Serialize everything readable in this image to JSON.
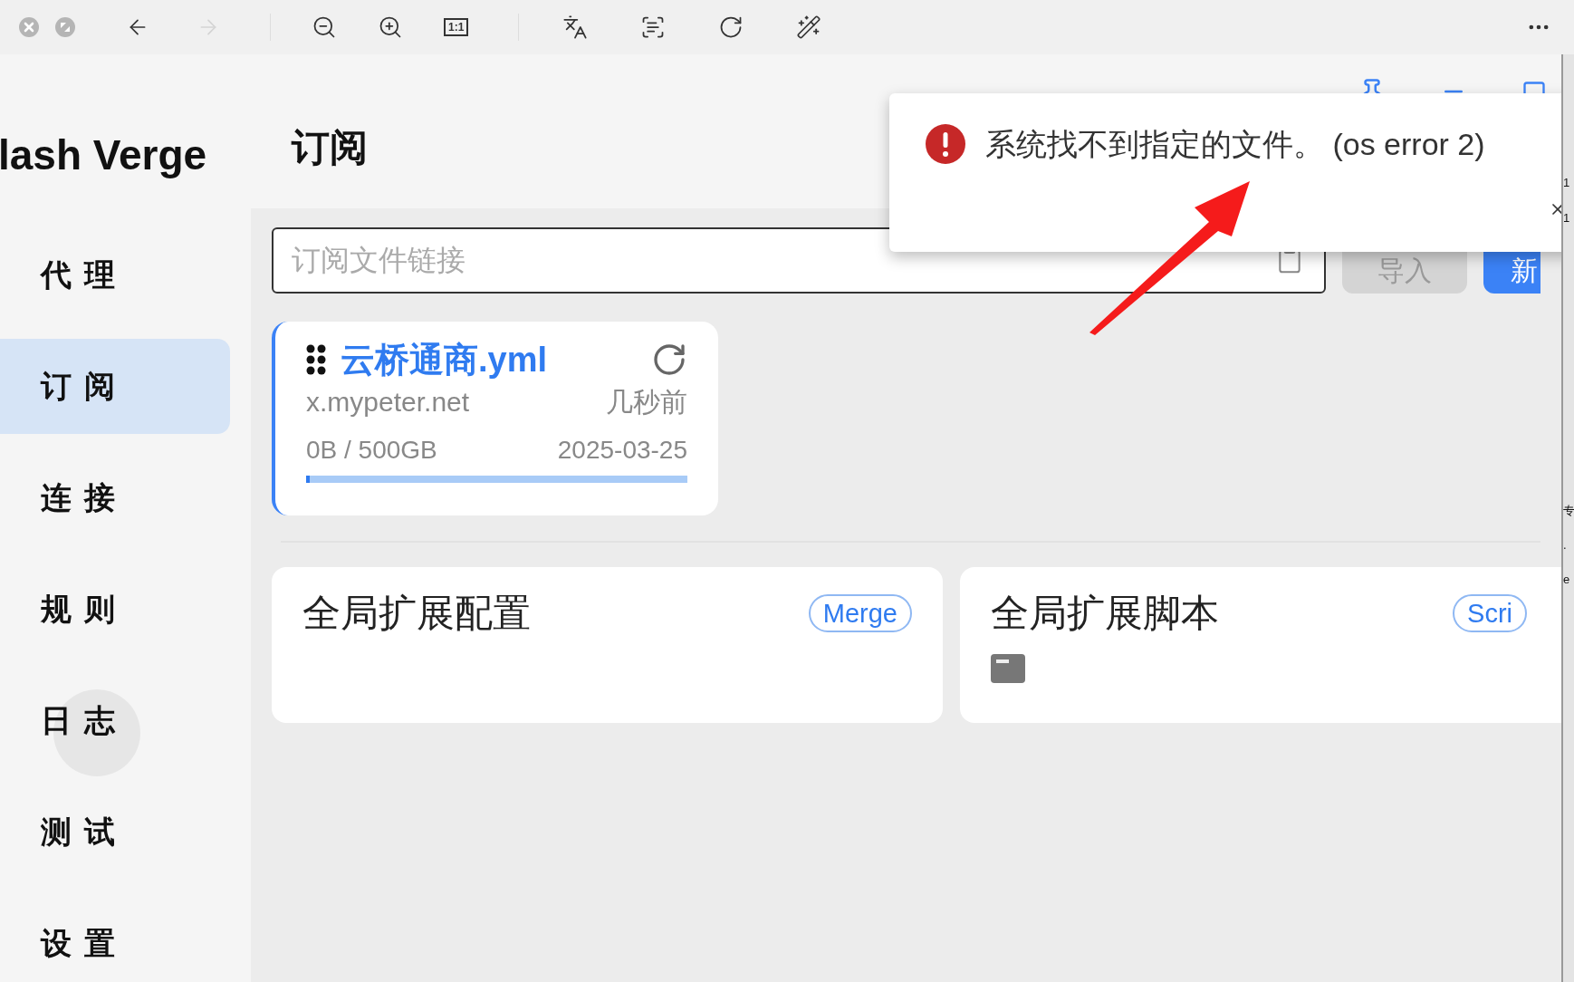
{
  "viewer_toolbar": {
    "window_buttons": [
      {
        "kind": "close"
      },
      {
        "kind": "restore"
      }
    ],
    "nav_buttons": [
      {
        "kind": "back",
        "disabled": false
      },
      {
        "kind": "forward",
        "disabled": true
      }
    ],
    "zoom_tools": [
      {
        "kind": "zoom-out"
      },
      {
        "kind": "zoom-in"
      },
      {
        "kind": "actual-size",
        "label": "1:1"
      }
    ],
    "image_tools": [
      {
        "kind": "translate"
      },
      {
        "kind": "scan-text"
      },
      {
        "kind": "rotate"
      },
      {
        "kind": "magic"
      }
    ]
  },
  "sidebar": {
    "logo": "lash Verge",
    "items": [
      {
        "label": "代理",
        "selected": false
      },
      {
        "label": "订阅",
        "selected": true
      },
      {
        "label": "连接",
        "selected": false
      },
      {
        "label": "规则",
        "selected": false
      },
      {
        "label": "日志",
        "selected": false
      },
      {
        "label": "测试",
        "selected": false
      },
      {
        "label": "设置",
        "selected": false
      }
    ]
  },
  "page": {
    "title": "订阅",
    "search": {
      "placeholder": "订阅文件链接"
    },
    "buttons": [
      {
        "label": "导入",
        "kind": "secondary",
        "disabled": true
      },
      {
        "label": "新",
        "kind": "primary",
        "disabled": false
      }
    ]
  },
  "profile": {
    "name": "云桥通商.yml",
    "host": "x.mypeter.net",
    "updated": "几秒前",
    "usage": "0B / 500GB",
    "expire": "2025-03-25",
    "level": 0.01,
    "selected": true
  },
  "enhance_cards": [
    {
      "title": "全局扩展配置",
      "tag": "Merge",
      "kind": "merge"
    },
    {
      "title": "全局扩展脚本",
      "tag": "Scri",
      "kind": "script"
    }
  ],
  "toast": {
    "message": "系统找不到指定的文件。 (os error 2)"
  },
  "right_strip": [
    "1",
    "1",
    "专",
    ".",
    "e"
  ]
}
